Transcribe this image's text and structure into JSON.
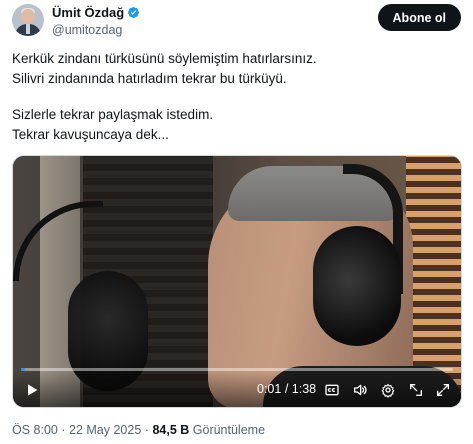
{
  "author": {
    "display_name": "Ümit Özdağ",
    "handle": "@umitozdag",
    "verified_icon": "verified-badge-icon",
    "verified_color": "#1d9bf0"
  },
  "follow_button": {
    "label": "Abone ol"
  },
  "tweet": {
    "lines": [
      "Kerkük zindanı türküsünü söylemiştim hatırlarsınız.",
      "Silivri zindanında hatırladım tekrar bu türküyü.",
      "Sizlerle tekrar paylaşmak istedim.",
      "Tekrar kavuşuncaya dek..."
    ]
  },
  "video": {
    "current_time": "0:01",
    "separator": "/",
    "duration": "1:38",
    "progress_fraction": 0.01,
    "accent_color": "#1d9bf0",
    "controls": [
      "play-icon",
      "captions-icon",
      "volume-icon",
      "settings-icon",
      "pip-icon",
      "fullscreen-icon"
    ]
  },
  "meta": {
    "time": "ÖS 8:00",
    "dot": "·",
    "date": "22 May 2025",
    "views_count": "84,5 B",
    "views_label": "Görüntüleme"
  }
}
